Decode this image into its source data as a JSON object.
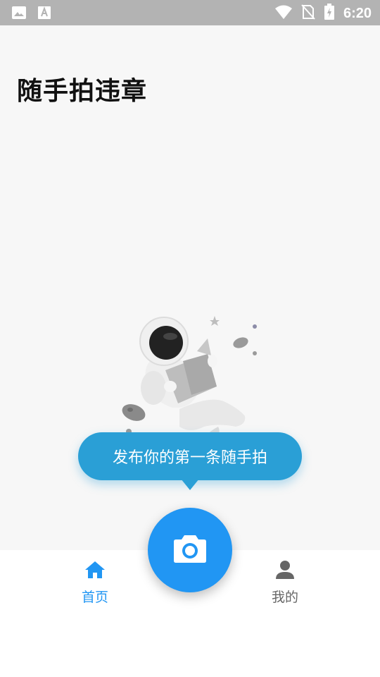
{
  "status_bar": {
    "time": "6:20",
    "icons": [
      "image-icon",
      "font-icon",
      "wifi-icon",
      "no-sim-icon",
      "battery-charging-icon"
    ]
  },
  "header": {
    "title": "随手拍违章"
  },
  "empty_state": {
    "illustration": "astronaut-reading-illustration",
    "tooltip_text": "发布你的第一条随手拍"
  },
  "bottom_nav": {
    "items": [
      {
        "label": "首页",
        "icon": "home-icon",
        "active": true
      },
      {
        "label": "我的",
        "icon": "person-icon",
        "active": false
      }
    ],
    "fab_icon": "camera-icon"
  },
  "colors": {
    "accent": "#2196f3",
    "tooltip": "#2a9fd6",
    "background": "#f7f7f7",
    "status_bar": "#b3b3b3"
  }
}
